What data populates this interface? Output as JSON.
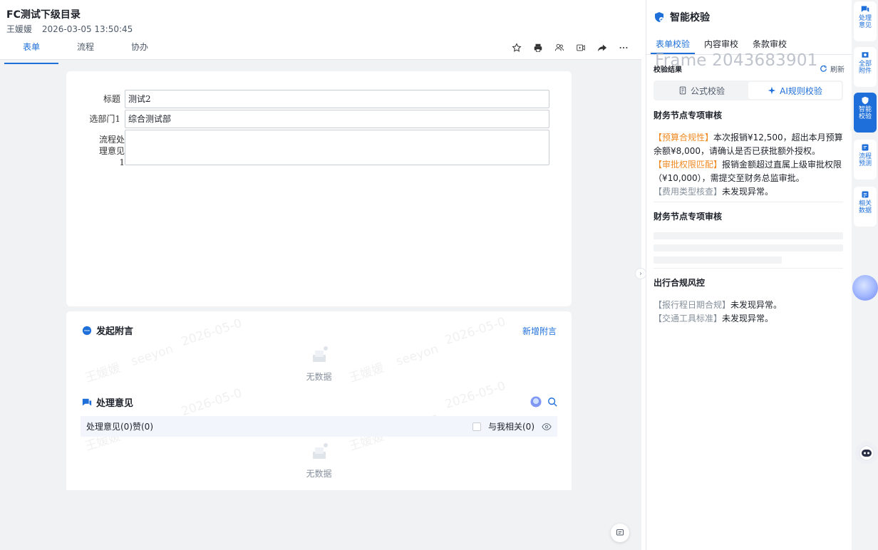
{
  "header": {
    "title": "FC测试下级目录",
    "author": "王媛媛",
    "datetime": "2026-03-05 13:50:45",
    "tabs": [
      {
        "label": "表单",
        "active": true
      },
      {
        "label": "流程",
        "active": false
      },
      {
        "label": "协办",
        "active": false
      }
    ],
    "toolbar_icons": [
      "star-icon",
      "print-icon",
      "users-icon",
      "video-icon",
      "share-icon",
      "more-icon"
    ]
  },
  "form": {
    "fields": [
      {
        "label": "标题",
        "value": "测试2"
      },
      {
        "label": "选部门1",
        "value": "综合测试部"
      },
      {
        "label": "流程处理意见1",
        "value": ""
      }
    ]
  },
  "comments": {
    "attach_title": "发起附言",
    "add_label": "新增附言",
    "empty_text": "无数据",
    "opinion_title": "处理意见",
    "filter_label": "处理意见(0)赞(0)",
    "related_label": "与我相关(0)",
    "empty_text_2": "无数据",
    "watermark_name": "王媛媛",
    "watermark_brand": "seeyon",
    "watermark_date": "2026-05-0"
  },
  "panel": {
    "title": "智能校验",
    "tabs": [
      {
        "label": "表单校验",
        "active": true
      },
      {
        "label": "内容审校",
        "active": false
      },
      {
        "label": "条款审校",
        "active": false
      }
    ],
    "ghost_text": "Frame 2043683901",
    "result_label": "校验结果",
    "refresh_label": "刷新",
    "segments": [
      {
        "label": "公式校验",
        "active": false
      },
      {
        "label": "AI规则校验",
        "active": true
      }
    ],
    "block1": {
      "title": "财务节点专项审核",
      "lines": [
        {
          "tag": "【预算合规性】",
          "text": "本次报销¥12,500，超出本月预算余额¥8,000，请确认是否已获批额外授权。",
          "tone": "orange"
        },
        {
          "tag": "【审批权限匹配】",
          "text": "报销金额超过直属上级审批权限（¥10,000），需提交至财务总监审批。",
          "tone": "orange"
        },
        {
          "tag": "【费用类型核查】",
          "text": "未发现异常。",
          "tone": "grey"
        }
      ]
    },
    "block2": {
      "title": "财务节点专项审核"
    },
    "block3": {
      "title": "出行合规风控",
      "lines": [
        {
          "tag": "【报行程日期合规】",
          "text": "未发现异常。",
          "tone": "grey"
        },
        {
          "tag": "【交通工具标准】",
          "text": "未发现异常。",
          "tone": "grey"
        }
      ]
    }
  },
  "rail": {
    "items": [
      {
        "label": "处理意见",
        "active": false
      },
      {
        "label": "全部附件",
        "active": false
      },
      {
        "label": "智能校验",
        "active": true
      },
      {
        "label": "流程预测",
        "active": false
      },
      {
        "label": "相关数据",
        "active": false
      }
    ]
  },
  "colors": {
    "accent": "#1e6fd9",
    "warn": "#f08a24",
    "muted": "#86909c"
  }
}
